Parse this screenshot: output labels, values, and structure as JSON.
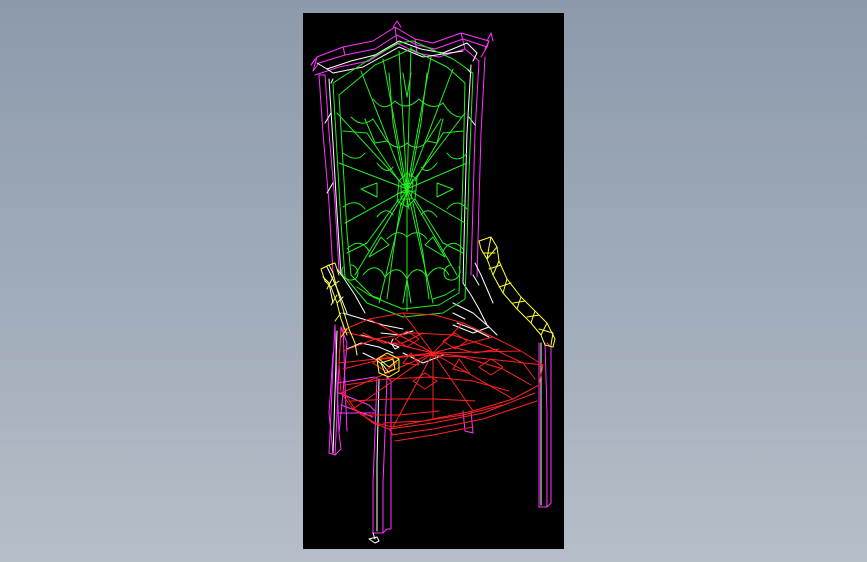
{
  "viewport": {
    "background": "#000000"
  },
  "colors": {
    "frame": "#ff33ff",
    "edge": "#ffffff",
    "backrest": "#22ee22",
    "seat": "#ff2020",
    "armrest": "#ffff33"
  },
  "icons": {
    "model": "chair-wireframe"
  }
}
